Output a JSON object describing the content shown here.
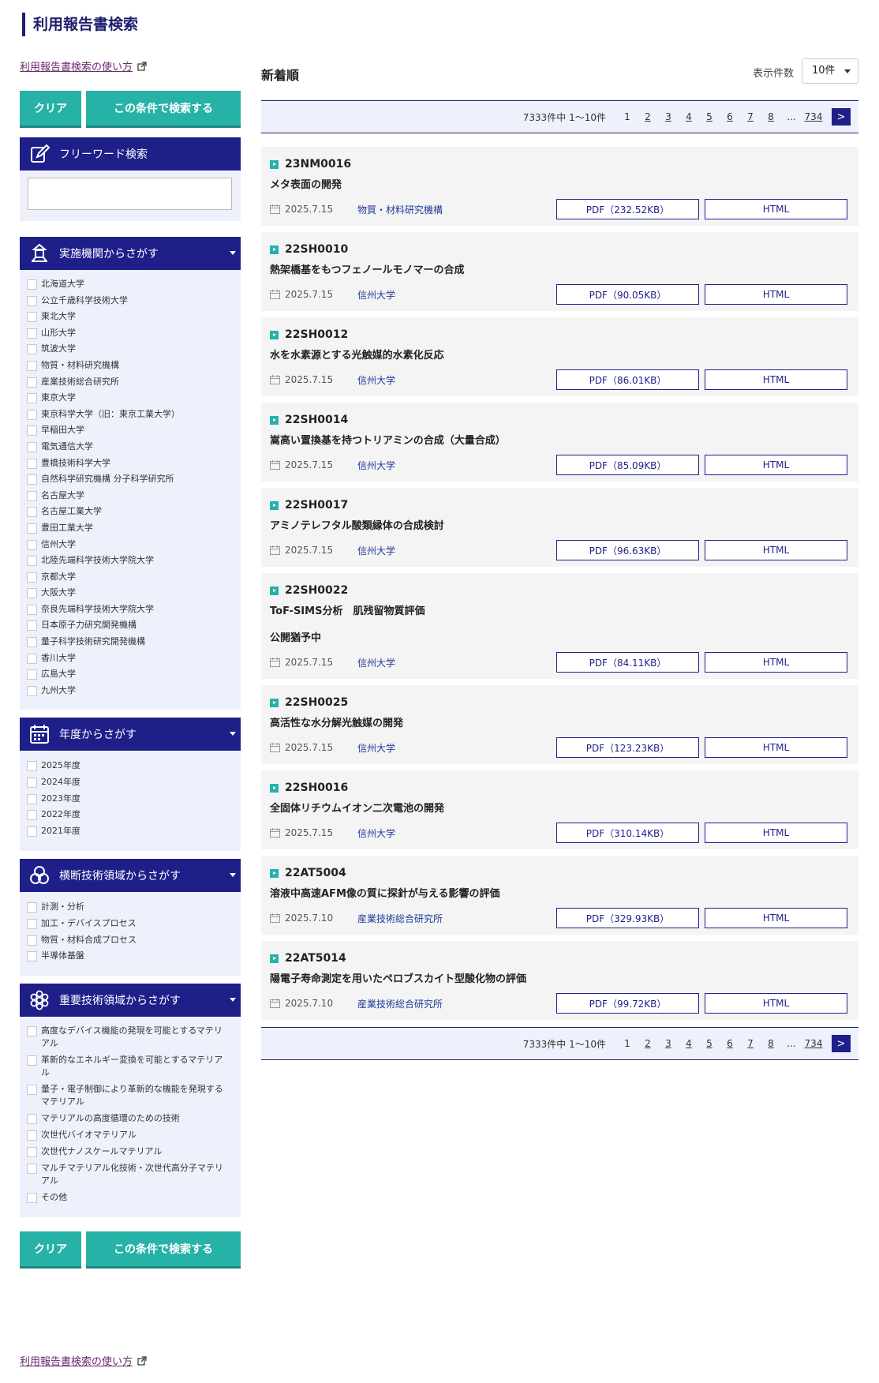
{
  "page": {
    "title": "利用報告書検索"
  },
  "sidebar": {
    "howto_label": "利用報告書検索の使い方",
    "clear_label": "クリア",
    "search_label": "この条件で検索する",
    "free": {
      "title": "フリーワード検索",
      "value": ""
    },
    "institutions": {
      "title": "実施機関からさがす",
      "items": [
        "北海道大学",
        "公立千歳科学技術大学",
        "東北大学",
        "山形大学",
        "筑波大学",
        "物質・材料研究機構",
        "産業技術総合研究所",
        "東京大学",
        "東京科学大学（旧：東京工業大学）",
        "早稲田大学",
        "電気通信大学",
        "豊橋技術科学大学",
        "自然科学研究機構 分子科学研究所",
        "名古屋大学",
        "名古屋工業大学",
        "豊田工業大学",
        "信州大学",
        "北陸先端科学技術大学院大学",
        "京都大学",
        "大阪大学",
        "奈良先端科学技術大学院大学",
        "日本原子力研究開発機構",
        "量子科学技術研究開発機構",
        "香川大学",
        "広島大学",
        "九州大学"
      ]
    },
    "years": {
      "title": "年度からさがす",
      "items": [
        "2025年度",
        "2024年度",
        "2023年度",
        "2022年度",
        "2021年度"
      ]
    },
    "cross_fields": {
      "title": "横断技術領域からさがす",
      "items": [
        "計測・分析",
        "加工・デバイスプロセス",
        "物質・材料合成プロセス",
        "半導体基盤"
      ]
    },
    "key_fields": {
      "title": "重要技術領域からさがす",
      "items": [
        "高度なデバイス機能の発現を可能とするマテリアル",
        "革新的なエネルギー変換を可能とするマテリアル",
        "量子・電子制御により革新的な機能を発現するマテリアル",
        "マテリアルの高度循環のための技術",
        "次世代バイオマテリアル",
        "次世代ナノスケールマテリアル",
        "マルチマテリアル化技術・次世代高分子マテリアル",
        "その他"
      ]
    }
  },
  "main": {
    "sort_title": "新着順",
    "per_page_label": "表示件数",
    "per_page_value": "10件",
    "pager": {
      "count": "7333件中 1〜10件",
      "pages": [
        "1",
        "2",
        "3",
        "4",
        "5",
        "6",
        "7",
        "8"
      ],
      "ellipsis": "...",
      "last": "734",
      "next": ">"
    },
    "html_label": "HTML",
    "reports": [
      {
        "id": "23NM0016",
        "title": "メタ表面の開発",
        "date": "2025.7.15",
        "inst": "物質・材料研究機構",
        "pdf": "PDF（232.52KB）"
      },
      {
        "id": "22SH0010",
        "title": "熱架橋基をもつフェノールモノマーの合成",
        "date": "2025.7.15",
        "inst": "信州大学",
        "pdf": "PDF（90.05KB）"
      },
      {
        "id": "22SH0012",
        "title": "水を水素源とする光触媒的水素化反応",
        "date": "2025.7.15",
        "inst": "信州大学",
        "pdf": "PDF（86.01KB）"
      },
      {
        "id": "22SH0014",
        "title": "嵩高い置換基を持つトリアミンの合成（大量合成）",
        "date": "2025.7.15",
        "inst": "信州大学",
        "pdf": "PDF（85.09KB）"
      },
      {
        "id": "22SH0017",
        "title": "アミノテレフタル酸類縁体の合成検討",
        "date": "2025.7.15",
        "inst": "信州大学",
        "pdf": "PDF（96.63KB）"
      },
      {
        "id": "22SH0022",
        "title": "ToF-SIMS分析　肌残留物質評価\n\n公開猶予中",
        "date": "2025.7.15",
        "inst": "信州大学",
        "pdf": "PDF（84.11KB）"
      },
      {
        "id": "22SH0025",
        "title": "高活性な水分解光触媒の開発",
        "date": "2025.7.15",
        "inst": "信州大学",
        "pdf": "PDF（123.23KB）"
      },
      {
        "id": "22SH0016",
        "title": "全固体リチウムイオン二次電池の開発",
        "date": "2025.7.15",
        "inst": "信州大学",
        "pdf": "PDF（310.14KB）"
      },
      {
        "id": "22AT5004",
        "title": "溶液中高速AFM像の質に探針が与える影響の評価",
        "date": "2025.7.10",
        "inst": "産業技術総合研究所",
        "pdf": "PDF（329.93KB）"
      },
      {
        "id": "22AT5014",
        "title": "陽電子寿命測定を用いたペロブスカイト型酸化物の評価",
        "date": "2025.7.10",
        "inst": "産業技術総合研究所",
        "pdf": "PDF（99.72KB）"
      }
    ]
  }
}
